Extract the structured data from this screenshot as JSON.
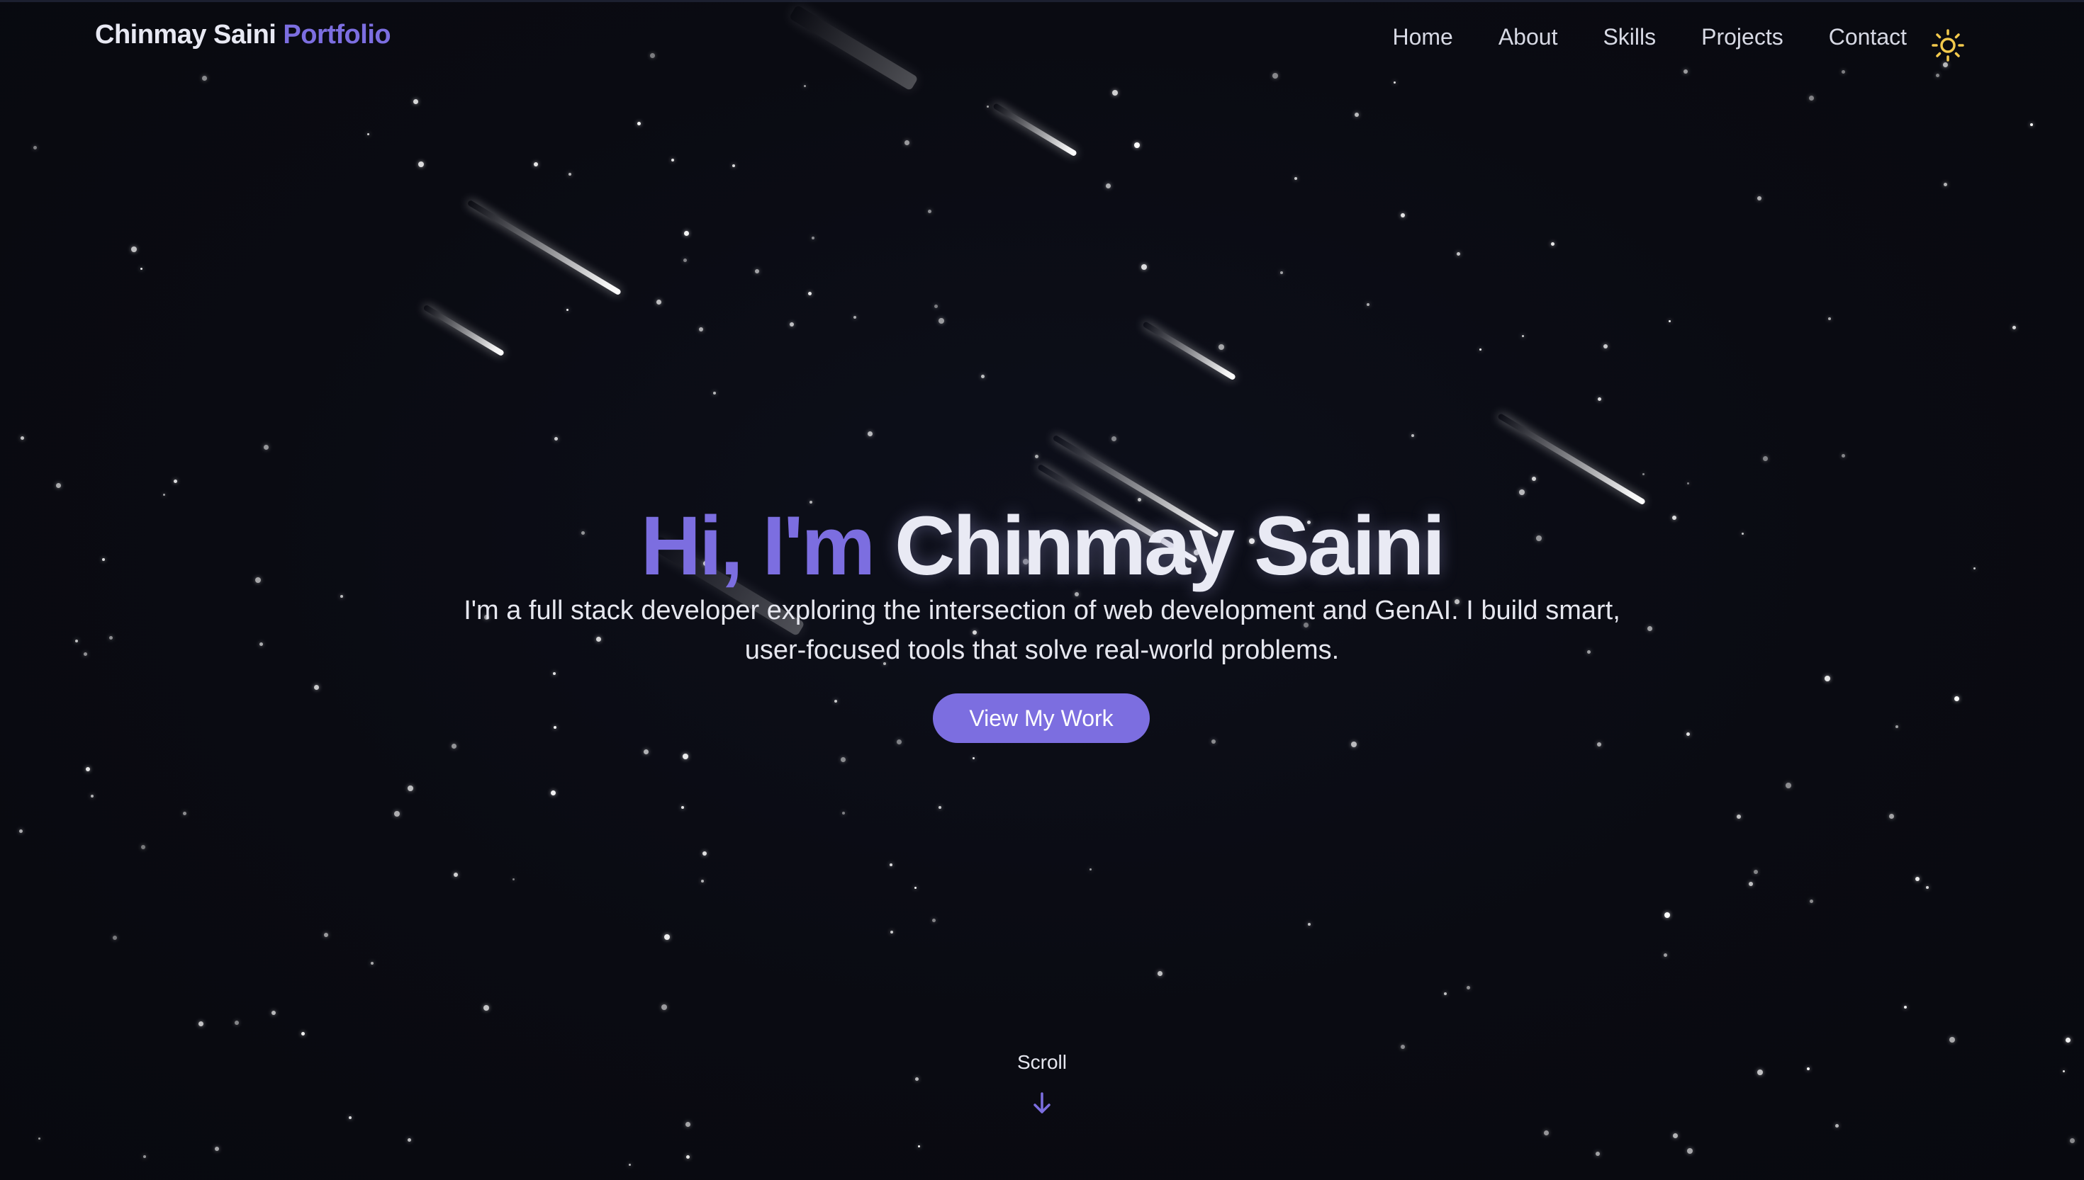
{
  "colors": {
    "background": "#0a0b12",
    "accent": "#7c6ee0",
    "text": "#e8e9f3",
    "sun_icon": "#f2c94c"
  },
  "header": {
    "brand_name": "Chinmay Saini",
    "brand_suffix": "Portfolio",
    "nav": [
      {
        "label": "Home"
      },
      {
        "label": "About"
      },
      {
        "label": "Skills"
      },
      {
        "label": "Projects"
      },
      {
        "label": "Contact"
      }
    ],
    "theme_toggle_icon": "sun-icon"
  },
  "hero": {
    "greeting": "Hi, I'm",
    "name": "Chinmay Saini",
    "description": "I'm a full stack developer exploring the intersection of web development and GenAI. I build smart, user-focused tools that solve real-world problems.",
    "cta_label": "View My Work"
  },
  "scroll": {
    "label": "Scroll",
    "icon": "arrow-down-icon"
  }
}
